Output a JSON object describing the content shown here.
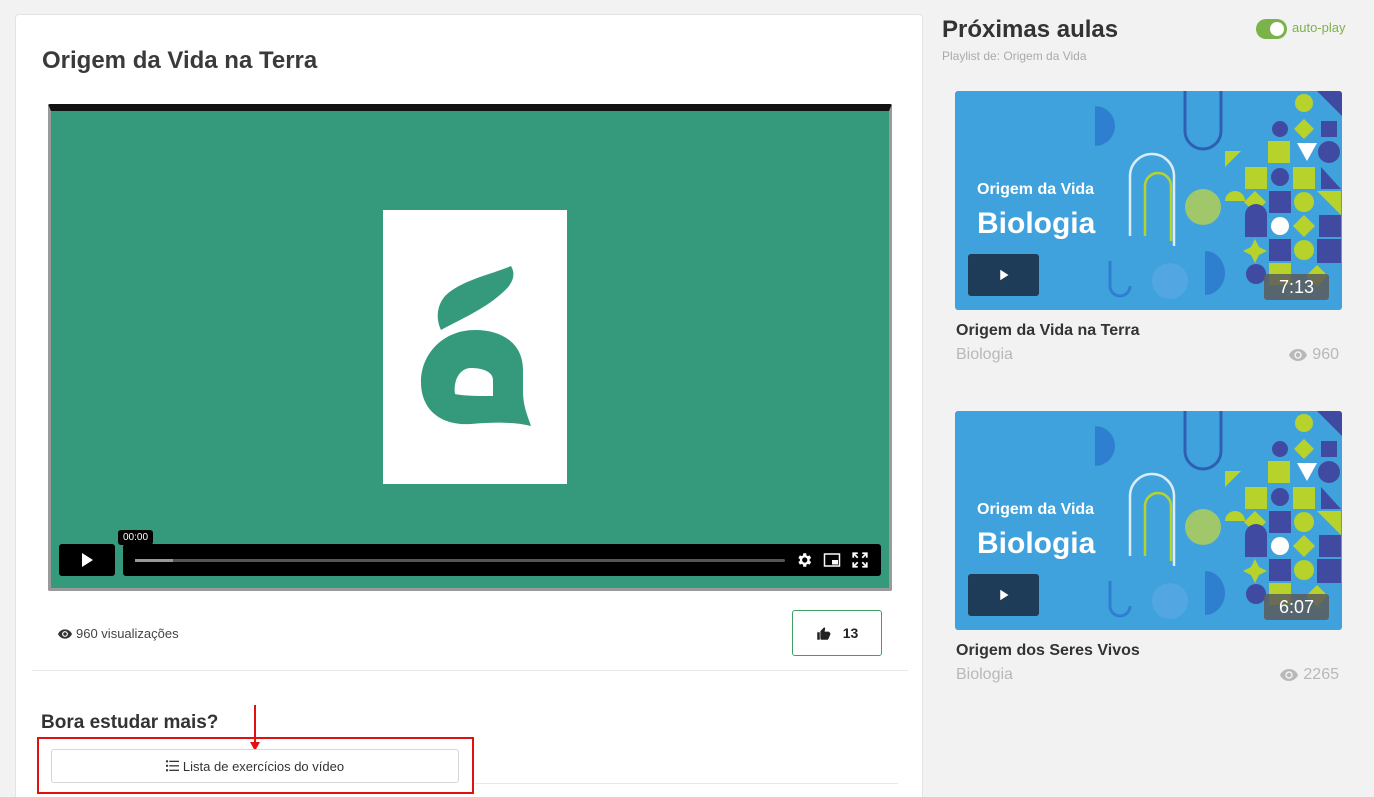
{
  "video": {
    "title": "Origem da Vida na Terra",
    "tooltip_time": "00:00",
    "views": "960 visualizações",
    "likes": "13"
  },
  "study": {
    "heading": "Bora estudar mais?",
    "list_button_label": "Lista de exercícios do vídeo"
  },
  "sidebar": {
    "title": "Próximas aulas",
    "playlist": "Playlist de: Origem da Vida",
    "autoplay_label": "auto-play",
    "autoplay_on": true,
    "items": [
      {
        "thumb_subtitle": "Origem da Vida",
        "thumb_title": "Biologia",
        "duration": "7:13",
        "title": "Origem da Vida na Terra",
        "category": "Biologia",
        "views": "960"
      },
      {
        "thumb_subtitle": "Origem da Vida",
        "thumb_title": "Biologia",
        "duration": "6:07",
        "title": "Origem dos Seres Vivos",
        "category": "Biologia",
        "views": "2265"
      }
    ]
  },
  "colors": {
    "player_bg": "#35997c",
    "accent_green": "#7bb34a",
    "like_border": "#3fa066",
    "annotation_red": "#e21010",
    "thumb_bg": "#40a2dc"
  }
}
